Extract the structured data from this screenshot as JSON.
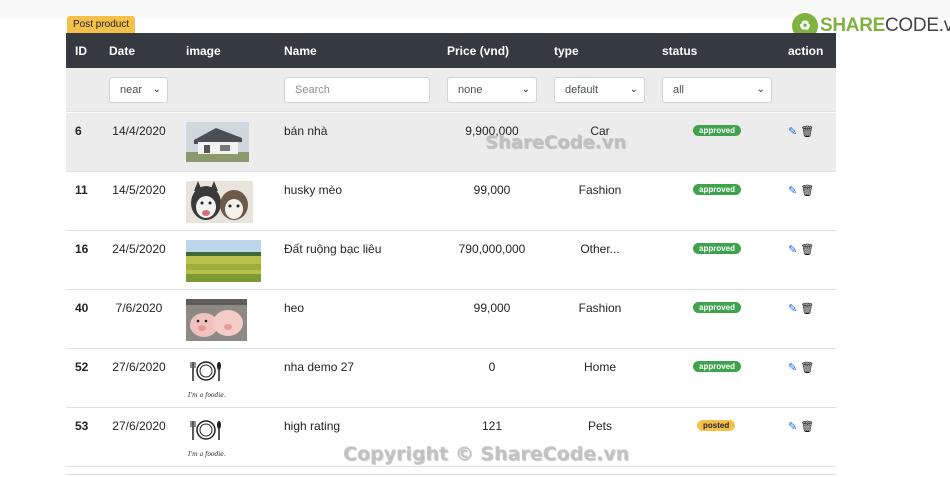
{
  "branding": {
    "logo_text_1": "SHARE",
    "logo_text_2": "CODE.vn",
    "watermark_top": "ShareCode.vn",
    "watermark_bottom": "Copyright © ShareCode.vn"
  },
  "tab": {
    "label": "Post product"
  },
  "columns": {
    "id": "ID",
    "date": "Date",
    "image": "image",
    "name": "Name",
    "price": "Price (vnd)",
    "type": "type",
    "status": "status",
    "action": "action"
  },
  "filters": {
    "date": "near",
    "search_placeholder": "Search",
    "price": "none",
    "type": "default",
    "status": "all"
  },
  "rows": [
    {
      "id": "6",
      "date": "14/4/2020",
      "name": "bán nhà",
      "price": "9,900,000",
      "type": "Car",
      "status": "approved",
      "image": "house-photo"
    },
    {
      "id": "11",
      "date": "14/5/2020",
      "name": "husky mèo",
      "price": "99,000",
      "type": "Fashion",
      "status": "approved",
      "image": "husky-dogs-photo"
    },
    {
      "id": "16",
      "date": "24/5/2020",
      "name": "Đất ruộng bạc liêu",
      "price": "790,000,000",
      "type": "Other...",
      "status": "approved",
      "image": "rice-field-photo"
    },
    {
      "id": "40",
      "date": "7/6/2020",
      "name": "heo",
      "price": "99,000",
      "type": "Fashion",
      "status": "approved",
      "image": "pigs-photo"
    },
    {
      "id": "52",
      "date": "27/6/2020",
      "name": "nha demo 27",
      "price": "0",
      "type": "Home",
      "status": "approved",
      "image": "foodie-logo"
    },
    {
      "id": "53",
      "date": "27/6/2020",
      "name": "high rating",
      "price": "121",
      "type": "Pets",
      "status": "posted",
      "image": "foodie-logo"
    }
  ],
  "foodie_caption": "I'm a foodie."
}
